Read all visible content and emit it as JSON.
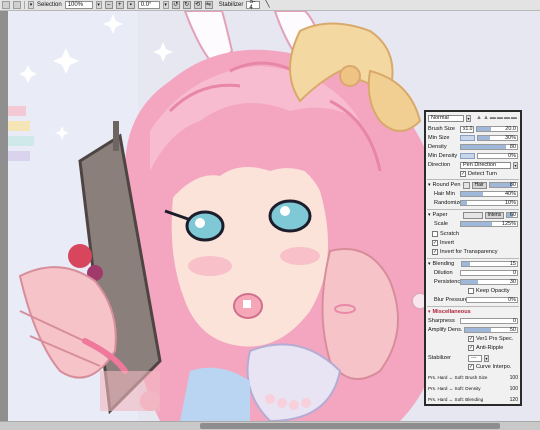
{
  "toolbar": {
    "selection_label": "Selection",
    "zoom": "100%",
    "rotation": "0.0°",
    "stabilizer_label": "Stabilizer",
    "stabilizer_value": "S-4"
  },
  "panel": {
    "blend_mode": "Normal",
    "brush_size": {
      "label": "Brush Size",
      "mult": "x1.0",
      "value": "20.0",
      "level": 0.35
    },
    "min_size": {
      "label": "Min Size",
      "value": "30%",
      "level": 0.3
    },
    "density": {
      "label": "Density",
      "value": "80",
      "level": 0.8
    },
    "min_density": {
      "label": "Min Density",
      "value": "0%",
      "level": 0.0
    },
    "direction": {
      "label": "Direction",
      "value": "Pen Direction"
    },
    "detect_turn": "Detect Turn",
    "round_pen": {
      "label": "Round Pen",
      "hair_btn": "Hair",
      "value": "80"
    },
    "hair_min": {
      "label": "Hair Min",
      "value": "40%",
      "level": 0.4
    },
    "randomize": {
      "label": "Randomize",
      "value": "10%",
      "level": 0.1
    },
    "paper": {
      "label": "Paper",
      "intens_btn": "Intens",
      "value": "60"
    },
    "scale": {
      "label": "Scale",
      "value": "125%",
      "level": 0.55
    },
    "scratch": "Scratch",
    "invert": "Invert",
    "invert_transparency": "Invert for Transparency",
    "blending": {
      "label": "Blending",
      "value": "15",
      "level": 0.15
    },
    "dilution": {
      "label": "Dilution",
      "value": "0",
      "level": 0.0
    },
    "persistence": {
      "label": "Persistence",
      "value": "30",
      "level": 0.3
    },
    "keep_opacity": "Keep Opacity",
    "blur_pressure": {
      "label": "Blur Pressure",
      "value": "0%",
      "level": 0.0
    },
    "misc": {
      "label": "Miscellaneous"
    },
    "sharpness": {
      "label": "Sharpness",
      "value": "0",
      "level": 0.0
    },
    "amplify": {
      "label": "Amplify Dens.",
      "value": "50",
      "level": 0.5
    },
    "ver1_spec": "Ver1 Prs Spec.",
    "anti_ripple": "Anti-Ripple",
    "stabilizer": {
      "label": "Stabilizer",
      "value": "---"
    },
    "curve_interp": "Curve Interpo.",
    "prs_brush": {
      "label": "Prs. Hard ↔ Soft: Brush Size",
      "value": "100"
    },
    "prs_density": {
      "label": "Prs. Hard ↔ Soft: Density",
      "value": "100"
    },
    "prs_blending": {
      "label": "Prs. Hard ↔ Soft: Blending",
      "value": "120"
    }
  },
  "colors": {
    "bar_fill": "#9fb7d9",
    "hair_pink": "#f4a6c1",
    "bow_yellow": "#f3d8a2",
    "skin": "#fbe3da",
    "eye_teal": "#7fc8d6"
  }
}
